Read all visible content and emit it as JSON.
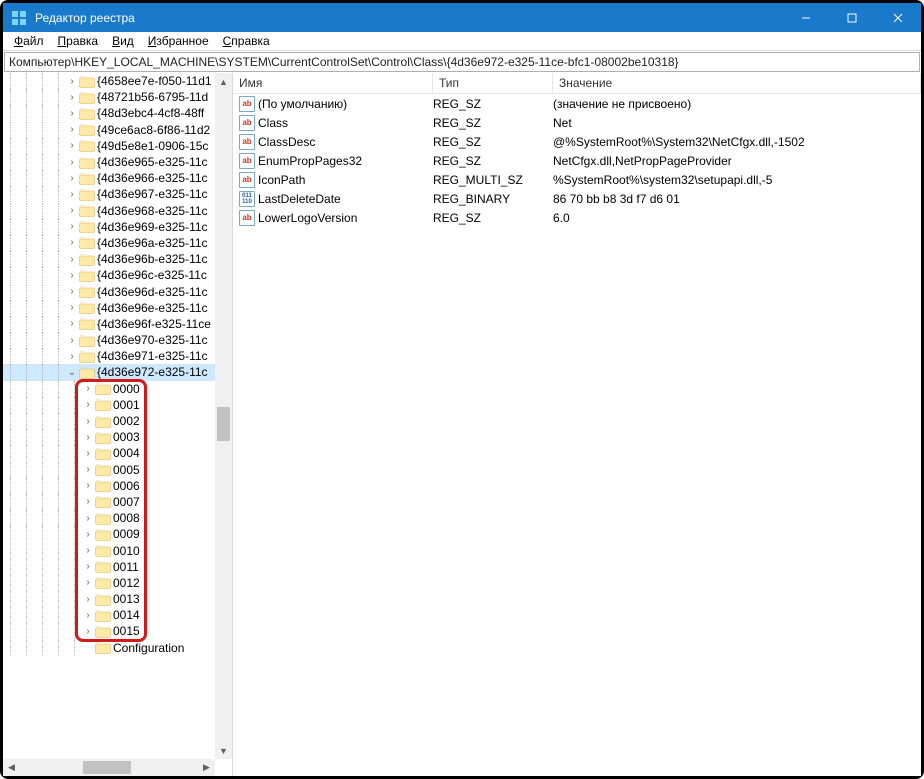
{
  "window": {
    "title": "Редактор реестра"
  },
  "menubar": {
    "items": [
      {
        "label": "Файл",
        "ul": 0
      },
      {
        "label": "Правка",
        "ul": 0
      },
      {
        "label": "Вид",
        "ul": 0
      },
      {
        "label": "Избранное",
        "ul": 0
      },
      {
        "label": "Справка",
        "ul": 0
      }
    ]
  },
  "address": "Компьютер\\HKEY_LOCAL_MACHINE\\SYSTEM\\CurrentControlSet\\Control\\Class\\{4d36e972-e325-11ce-bfc1-08002be10318}",
  "tree": {
    "indent_base": 40,
    "top": [
      {
        "label": "{4658ee7e-f050-11d1",
        "indent": 72
      },
      {
        "label": "{48721b56-6795-11d",
        "indent": 72
      },
      {
        "label": "{48d3ebc4-4cf8-48ff",
        "indent": 72
      },
      {
        "label": "{49ce6ac8-6f86-11d2",
        "indent": 72
      },
      {
        "label": "{49d5e8e1-0906-15c",
        "indent": 72
      },
      {
        "label": "{4d36e965-e325-11c",
        "indent": 72
      },
      {
        "label": "{4d36e966-e325-11c",
        "indent": 72
      },
      {
        "label": "{4d36e967-e325-11c",
        "indent": 72
      },
      {
        "label": "{4d36e968-e325-11c",
        "indent": 72
      },
      {
        "label": "{4d36e969-e325-11c",
        "indent": 72
      },
      {
        "label": "{4d36e96a-e325-11c",
        "indent": 72
      },
      {
        "label": "{4d36e96b-e325-11c",
        "indent": 72
      },
      {
        "label": "{4d36e96c-e325-11c",
        "indent": 72
      },
      {
        "label": "{4d36e96d-e325-11c",
        "indent": 72
      },
      {
        "label": "{4d36e96e-e325-11c",
        "indent": 72
      },
      {
        "label": "{4d36e96f-e325-11ce",
        "indent": 72
      },
      {
        "label": "{4d36e970-e325-11c",
        "indent": 72
      },
      {
        "label": "{4d36e971-e325-11c",
        "indent": 72
      }
    ],
    "selected": {
      "label": "{4d36e972-e325-11c",
      "indent": 72
    },
    "children": [
      "0000",
      "0001",
      "0002",
      "0003",
      "0004",
      "0005",
      "0006",
      "0007",
      "0008",
      "0009",
      "0010",
      "0011",
      "0012",
      "0013",
      "0014",
      "0015"
    ],
    "bottom": [
      {
        "label": "Configuration",
        "indent": 88
      }
    ]
  },
  "columns": {
    "name": "Имя",
    "type": "Тип",
    "data": "Значение"
  },
  "values": [
    {
      "icon": "str",
      "name": "(По умолчанию)",
      "type": "REG_SZ",
      "data": "(значение не присвоено)"
    },
    {
      "icon": "str",
      "name": "Class",
      "type": "REG_SZ",
      "data": "Net"
    },
    {
      "icon": "str",
      "name": "ClassDesc",
      "type": "REG_SZ",
      "data": "@%SystemRoot%\\System32\\NetCfgx.dll,-1502"
    },
    {
      "icon": "str",
      "name": "EnumPropPages32",
      "type": "REG_SZ",
      "data": "NetCfgx.dll,NetPropPageProvider"
    },
    {
      "icon": "str",
      "name": "IconPath",
      "type": "REG_MULTI_SZ",
      "data": "%SystemRoot%\\system32\\setupapi.dll,-5"
    },
    {
      "icon": "bin",
      "name": "LastDeleteDate",
      "type": "REG_BINARY",
      "data": "86 70 bb b8 3d f7 d6 01"
    },
    {
      "icon": "str",
      "name": "LowerLogoVersion",
      "type": "REG_SZ",
      "data": "6.0"
    }
  ],
  "icons": {
    "str_label": "ab",
    "bin_label": "011\n110"
  }
}
